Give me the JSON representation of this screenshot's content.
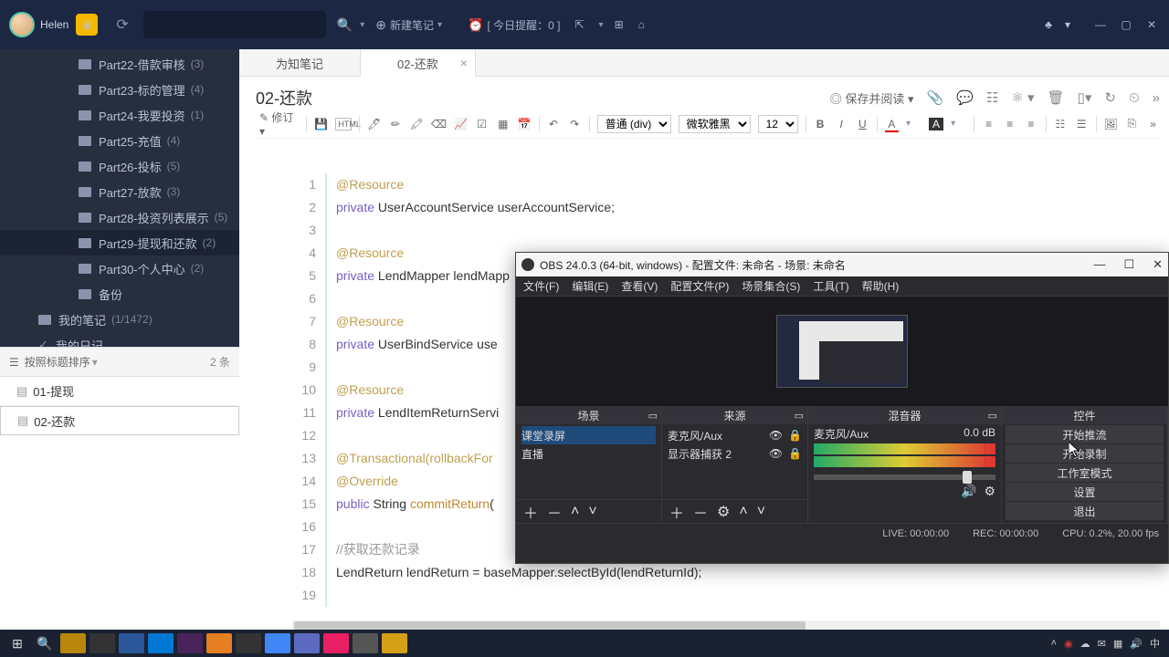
{
  "topbar": {
    "user": "Helen",
    "new_note": "新建笔记",
    "reminder": "[ 今日提醒：0 ]"
  },
  "sidebar": {
    "items": [
      {
        "label": "Part22-借款审核",
        "count": "(3)"
      },
      {
        "label": "Part23-标的管理",
        "count": "(4)"
      },
      {
        "label": "Part24-我要投资",
        "count": "(1)"
      },
      {
        "label": "Part25-充值",
        "count": "(4)"
      },
      {
        "label": "Part26-投标",
        "count": "(5)"
      },
      {
        "label": "Part27-放款",
        "count": "(3)"
      },
      {
        "label": "Part28-投资列表展示",
        "count": "(5)"
      },
      {
        "label": "Part29-提现和还款",
        "count": "(2)",
        "active": true
      },
      {
        "label": "Part30-个人中心",
        "count": "(2)"
      },
      {
        "label": "备份",
        "count": ""
      }
    ],
    "mine": "我的笔记",
    "mine_count": "(1/1472)",
    "diary": "我的日记"
  },
  "sortbar": {
    "label": "按照标题排序",
    "count": "2 条"
  },
  "notes": [
    {
      "label": "01-提现"
    },
    {
      "label": "02-还款",
      "sel": true
    }
  ],
  "tabs": [
    {
      "label": "为知笔记"
    },
    {
      "label": "02-还款",
      "active": true,
      "closable": true
    }
  ],
  "doc_title": "02-还款",
  "title_actions": {
    "save": "保存并阅读"
  },
  "toolbar": {
    "edit": "修订",
    "font_para": "普通 (div)",
    "font_family": "微软雅黑",
    "font_size": "12",
    "html": "HTML"
  },
  "code": {
    "lines": [
      {
        "n": 1,
        "t": "@Resource",
        "cls": "anno"
      },
      {
        "n": 2,
        "t": "private UserAccountService userAccountService;",
        "cls": "decl"
      },
      {
        "n": 3,
        "t": "",
        "cls": ""
      },
      {
        "n": 4,
        "t": "@Resource",
        "cls": "anno"
      },
      {
        "n": 5,
        "t": "private LendMapper lendMapp",
        "cls": "decl"
      },
      {
        "n": 6,
        "t": "",
        "cls": ""
      },
      {
        "n": 7,
        "t": "@Resource",
        "cls": "anno"
      },
      {
        "n": 8,
        "t": "private UserBindService use",
        "cls": "decl"
      },
      {
        "n": 9,
        "t": "",
        "cls": ""
      },
      {
        "n": 10,
        "t": "@Resource",
        "cls": "anno"
      },
      {
        "n": 11,
        "t": "private LendItemReturnServi",
        "cls": "decl"
      },
      {
        "n": 12,
        "t": "",
        "cls": ""
      },
      {
        "n": 13,
        "t": "@Transactional(rollbackFor",
        "cls": "anno"
      },
      {
        "n": 14,
        "t": "@Override",
        "cls": "anno"
      },
      {
        "n": 15,
        "t": "public String commitReturn(",
        "cls": "fn"
      },
      {
        "n": 16,
        "t": "",
        "cls": ""
      },
      {
        "n": 17,
        "t": "    //获取还款记录",
        "cls": "cmt"
      },
      {
        "n": 18,
        "t": "    LendReturn lendReturn = baseMapper.selectById(lendReturnId);",
        "cls": "decl"
      },
      {
        "n": 19,
        "t": "",
        "cls": ""
      }
    ]
  },
  "obs": {
    "title": "OBS 24.0.3 (64-bit, windows) - 配置文件: 未命名 - 场景: 未命名",
    "menu": [
      "文件(F)",
      "编辑(E)",
      "查看(V)",
      "配置文件(P)",
      "场景集合(S)",
      "工具(T)",
      "帮助(H)"
    ],
    "panel_scene": "场景",
    "panel_src": "来源",
    "panel_mix": "混音器",
    "panel_ctl": "控件",
    "scenes": [
      "课堂录屏",
      "直播"
    ],
    "sources": [
      "麦克风/Aux",
      "显示器捕获 2"
    ],
    "mix_label": "麦克风/Aux",
    "mix_db": "0.0 dB",
    "controls": [
      "开始推流",
      "开始录制",
      "工作室模式",
      "设置",
      "退出"
    ],
    "status_live": "LIVE: 00:00:00",
    "status_rec": "REC: 00:00:00",
    "status_cpu": "CPU: 0.2%, 20.00 fps"
  },
  "tray": {
    "ime": "中"
  }
}
